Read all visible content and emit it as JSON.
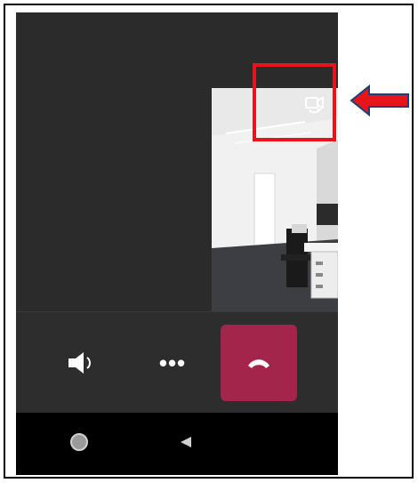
{
  "screen": {
    "description_labels": {
      "switch_camera": "switch-camera",
      "speaker": "speaker",
      "more": "more-options",
      "hangup": "end-call",
      "home": "home",
      "back": "back"
    }
  },
  "controls": {
    "more_label": "•••"
  },
  "colors": {
    "background_dark": "#2b2b2b",
    "controls_bar": "#2d2d2d",
    "hangup_red": "#a4254b",
    "nav_bar": "#000000",
    "annotation_red": "#e8141b",
    "arrow_fill": "#e8141b",
    "arrow_outline": "#1f3f7a"
  },
  "icons": {
    "switch_camera": "switch-camera-icon",
    "speaker": "speaker-icon",
    "more": "more-dots-icon",
    "hangup": "phone-hangup-icon",
    "home": "home-circle-icon",
    "back": "back-triangle-icon",
    "annotation_arrow": "left-arrow-icon"
  }
}
